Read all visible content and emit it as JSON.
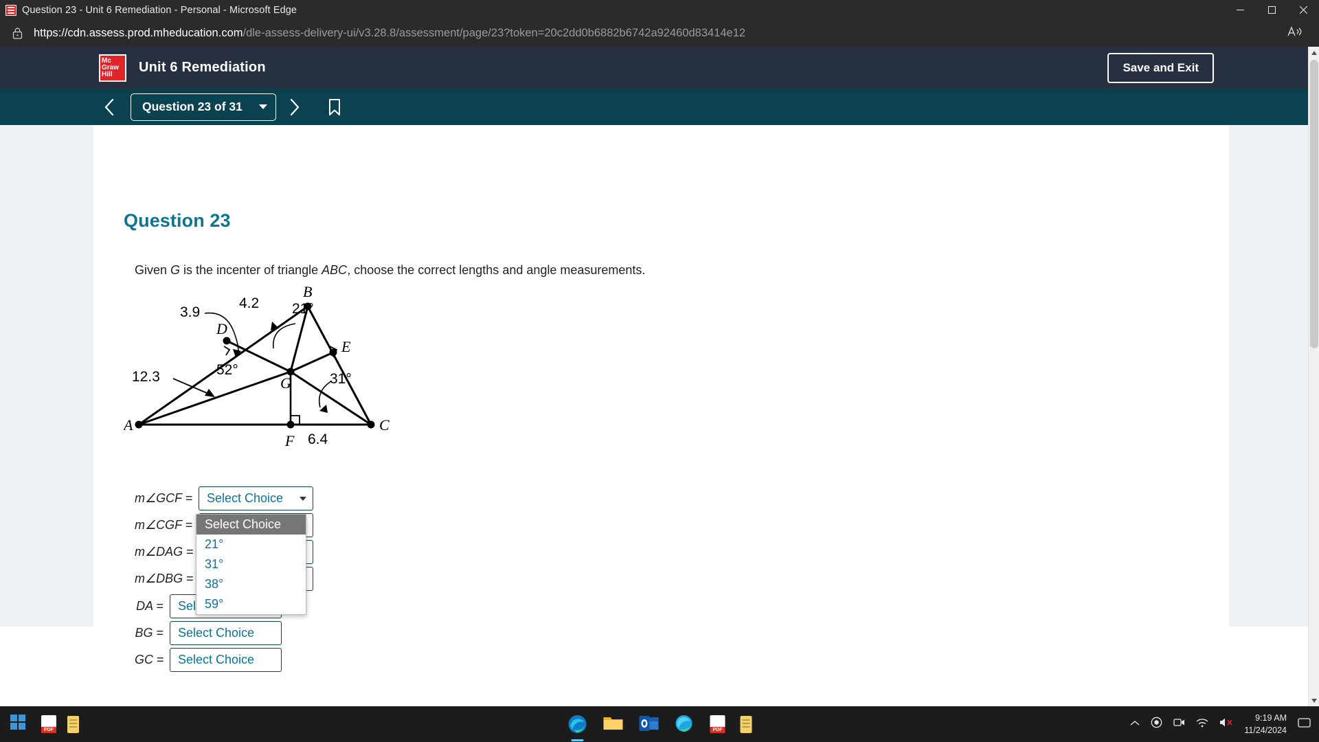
{
  "browser": {
    "tab_title": "Question 23 - Unit 6 Remediation - Personal - Microsoft Edge",
    "url_host": "https://cdn.assess.prod.mheducation.com",
    "url_path": "/dle-assess-delivery-ui/v3.28.8/assessment/page/23?token=20c2dd0b6882b6742a92460d83414e12",
    "read_aloud_label": "A",
    "window_controls": {
      "minimize": "minimize-button",
      "maximize": "maximize-button",
      "close": "close-button"
    }
  },
  "app": {
    "logo_lines": [
      "Mc",
      "Graw",
      "Hill"
    ],
    "title": "Unit 6 Remediation",
    "save_exit_label": "Save and Exit",
    "accent_teal": "#0a4250",
    "header_navy": "#26303f",
    "logo_red": "#e1242a",
    "link_teal": "#0e7490"
  },
  "qnav": {
    "prev_label": "previous-question",
    "selector_label": "Question 23 of 31",
    "next_label": "next-question",
    "bookmark_label": "bookmark"
  },
  "question": {
    "heading": "Question 23",
    "prompt_part1": "Given ",
    "prompt_var1": "G",
    "prompt_part2": " is the incenter of triangle ",
    "prompt_var2": "ABC",
    "prompt_part3": ", choose the correct lengths and angle measurements."
  },
  "diagram": {
    "vertices": [
      "A",
      "B",
      "C",
      "D",
      "E",
      "F",
      "G"
    ],
    "labels": {
      "A": "A",
      "B": "B",
      "C": "C",
      "D": "D",
      "E": "E",
      "F": "F",
      "G": "G"
    },
    "measures": {
      "AB_segment": "3.9",
      "DB_segment": "4.2",
      "AG_segment": "12.3",
      "angle_DGB": "52°",
      "angle_EBG": "21°",
      "angle_GCE": "31°",
      "FC_segment": "6.4"
    }
  },
  "answers": {
    "angle_rows": [
      {
        "label_m": "m",
        "label_angle": "∠",
        "label_pts": "GCF",
        "eq": "=",
        "value": "Select Choice"
      },
      {
        "label_m": "m",
        "label_angle": "∠",
        "label_pts": "CGF",
        "eq": "=",
        "value": "Select Choice"
      },
      {
        "label_m": "m",
        "label_angle": "∠",
        "label_pts": "DAG",
        "eq": "=",
        "value": "Select Choice"
      },
      {
        "label_m": "m",
        "label_angle": "∠",
        "label_pts": "DBG",
        "eq": "=",
        "value": "Select Choice"
      }
    ],
    "length_rows": [
      {
        "label": "DA",
        "eq": "=",
        "value": "Select Choice"
      },
      {
        "label": "BG",
        "eq": "=",
        "value": "Select Choice"
      },
      {
        "label": "GC",
        "eq": "=",
        "value": "Select Choice"
      }
    ]
  },
  "dropdown": {
    "open_for": "m∠CGF",
    "options": [
      "Select Choice",
      "21°",
      "31°",
      "38°",
      "59°"
    ],
    "selected_index": 0
  },
  "taskbar": {
    "start_label": "start-button",
    "time": "9:19 AM",
    "date": "11/24/2024",
    "pinned": [
      "pdf-file",
      "notes-file"
    ],
    "apps": [
      "microsoft-edge",
      "file-explorer",
      "outlook",
      "edge-dev",
      "pdf-file",
      "notes-file"
    ],
    "tray": [
      "chevron-up",
      "record",
      "camera",
      "wifi",
      "volume-muted"
    ]
  }
}
